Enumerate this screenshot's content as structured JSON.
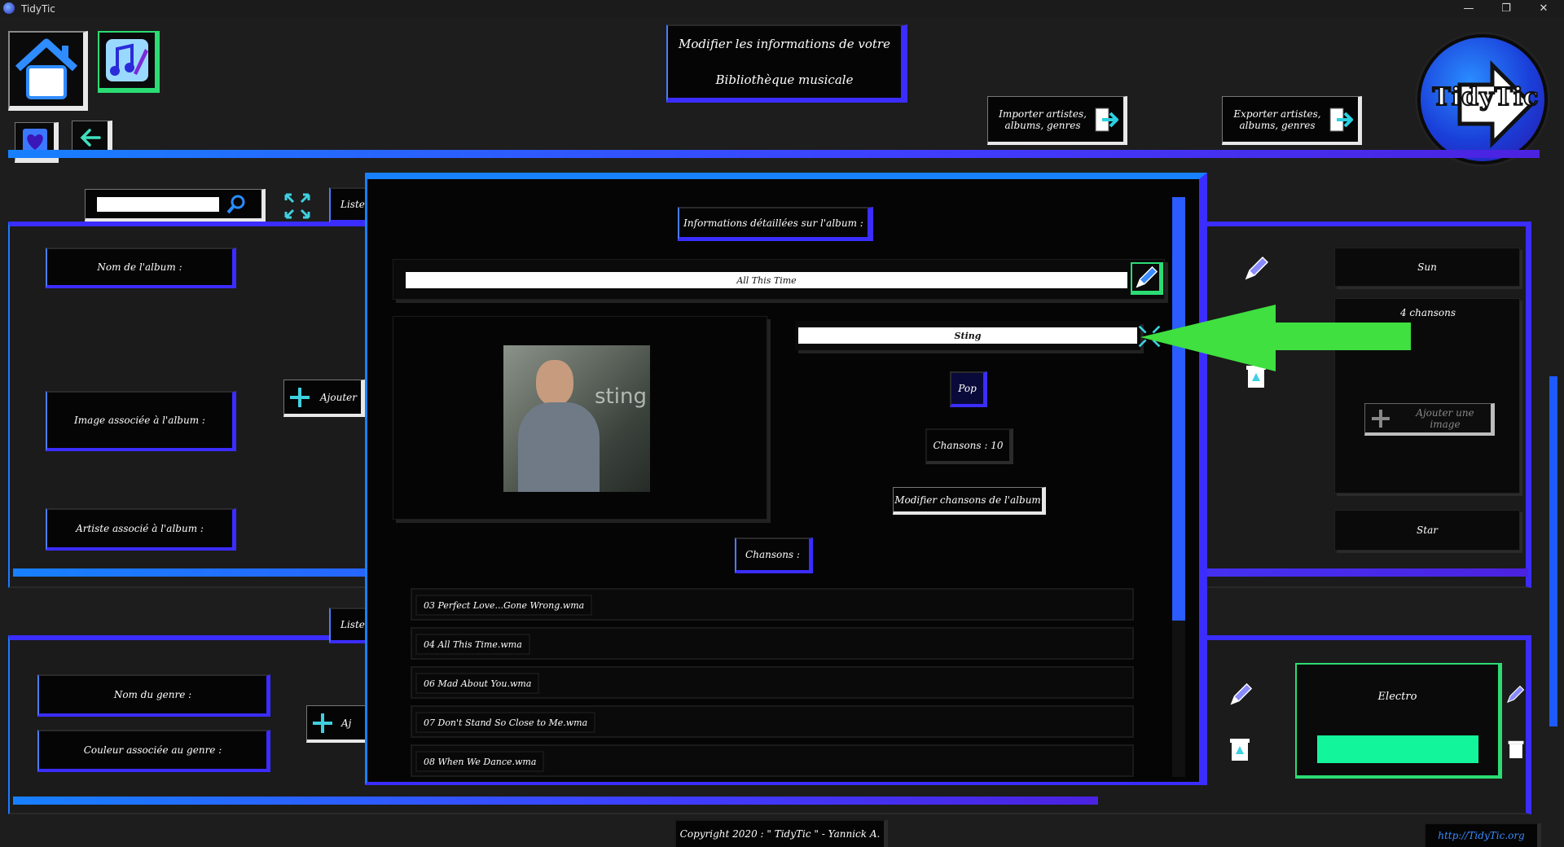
{
  "window": {
    "title": "TidyTic",
    "minimize": "—",
    "restore": "❐",
    "close": "✕"
  },
  "header": {
    "title_line1": "Modifier les informations de votre",
    "title_line2": "Bibliothèque musicale",
    "import_label": "Importer artistes, albums, genres",
    "export_label": "Exporter artistes, albums, genres",
    "logo_text": "TidyTic"
  },
  "search": {
    "placeholder": ""
  },
  "album_form": {
    "tab_label": "Liste",
    "name_label": "Nom de l'album :",
    "image_label": "Image associée à l'album :",
    "artist_label": "Artiste associé à l'album :",
    "add_label": "Ajouter"
  },
  "genre_form": {
    "tab_label": "Liste",
    "name_label": "Nom du genre :",
    "color_label": "Couleur associée au genre :",
    "add_label": "Aj"
  },
  "right_album": {
    "name": "Sun",
    "count": "4 chansons",
    "add_image": "Ajouter une image",
    "artist": "Star"
  },
  "right_genre": {
    "name": "Electro",
    "color": "#13f59a"
  },
  "dialog": {
    "heading": "Informations détaillées sur l'album :",
    "album_name": "All This Time",
    "artist": "Sting",
    "genre": "Pop",
    "songs_count": "Chansons  : 10",
    "edit_songs": "Modifier chansons de l'album",
    "songs_heading": "Chansons  :",
    "songs": [
      "03 Perfect Love...Gone Wrong.wma",
      "04 All This Time.wma",
      "06 Mad About You.wma",
      "07 Don't Stand So Close to Me.wma",
      "08 When We Dance.wma"
    ],
    "cover_text": "sting"
  },
  "footer": {
    "copyright": "Copyright 2020 : \" TidyTic \" - Yannick A.",
    "url": "http://TidyTic.org"
  },
  "colors": {
    "accent_blue": "#1780ff",
    "accent_purple": "#3b2dff",
    "accent_green": "#2bdc73",
    "arrow_green": "#3fe040"
  }
}
